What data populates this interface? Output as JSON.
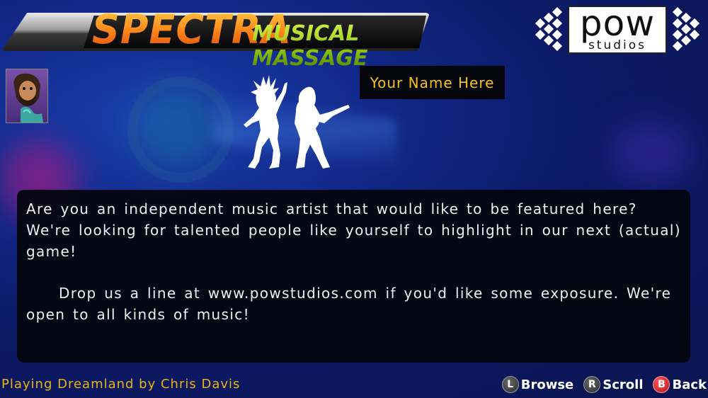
{
  "logo": {
    "title_main": "SPECTRA",
    "title_sub": "MUSICAL MASSAGE"
  },
  "brand": {
    "name": "pow",
    "sub": "studios"
  },
  "artist": {
    "name": "Your Name Here"
  },
  "panel": {
    "paragraph1": "Are you an independent music artist that would like to be featured here?  We're looking for talented people like yourself to highlight in our next (actual) game!",
    "paragraph2": "Drop us a line at www.powstudios.com if you'd like some exposure. We're open to all kinds of music!"
  },
  "footer": {
    "now_playing": "Playing Dreamland by Chris Davis",
    "controls": [
      {
        "button": "L",
        "label": "Browse"
      },
      {
        "button": "R",
        "label": "Scroll"
      },
      {
        "button": "B",
        "label": "Back"
      }
    ]
  },
  "colors": {
    "name_text": "#f4c21e",
    "now_playing_text": "#e8b41c",
    "back_button": "#d0141e"
  }
}
